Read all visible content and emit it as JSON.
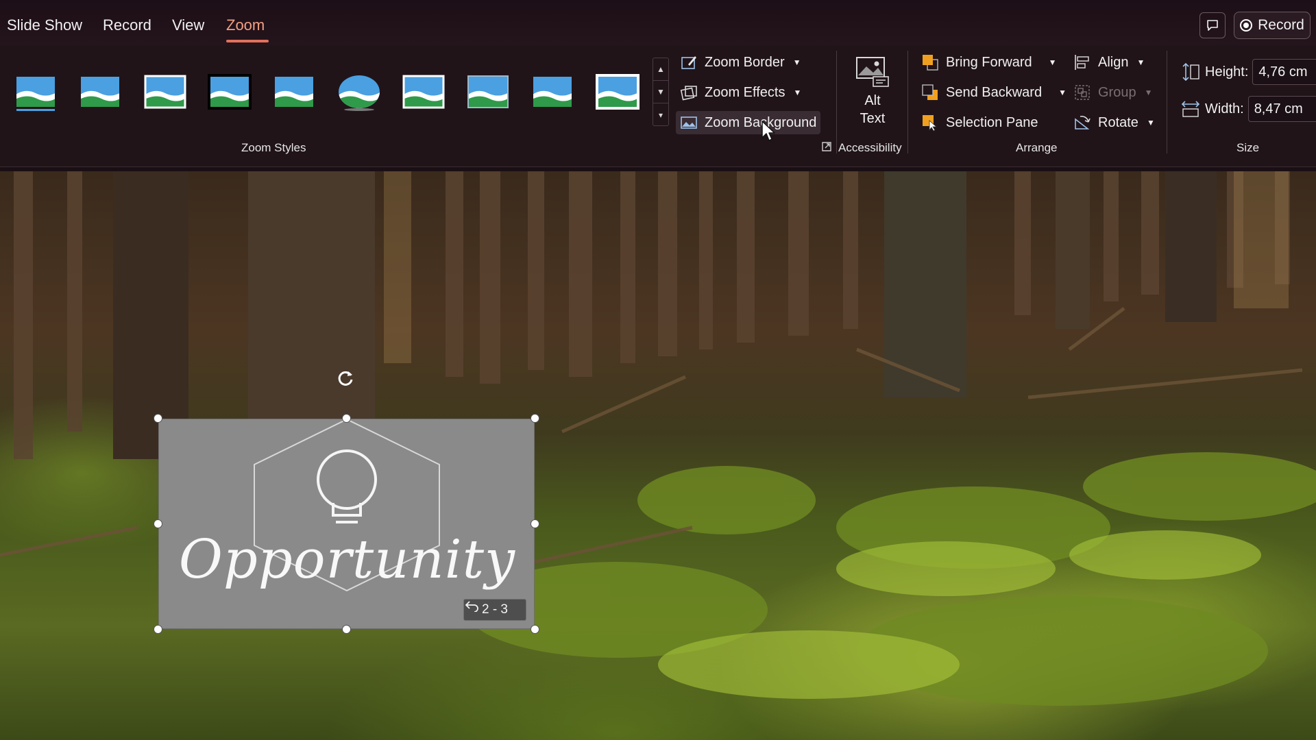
{
  "menu": {
    "tabs": [
      {
        "label": "Slide Show"
      },
      {
        "label": "Record"
      },
      {
        "label": "View"
      },
      {
        "label": "Zoom",
        "active": true
      }
    ],
    "record_button": "Record",
    "accent_color": "#e2705a"
  },
  "ribbon": {
    "zoom_styles": {
      "label": "Zoom Styles",
      "thumbnail_count": 10
    },
    "zoom_buttons": {
      "border": "Zoom Border",
      "effects": "Zoom Effects",
      "background": "Zoom Background"
    },
    "accessibility": {
      "label": "Accessibility",
      "alt_text_line1": "Alt",
      "alt_text_line2": "Text"
    },
    "arrange": {
      "label": "Arrange",
      "bring_forward": "Bring Forward",
      "send_backward": "Send Backward",
      "selection_pane": "Selection Pane",
      "align": "Align",
      "group": "Group",
      "rotate": "Rotate"
    },
    "size": {
      "label": "Size",
      "height_label": "Height:",
      "height_value": "4,76 cm",
      "width_label": "Width:",
      "width_value": "8,47 cm"
    }
  },
  "slide": {
    "zoom_object": {
      "title": "Opportunity",
      "badge": "2 - 3",
      "fill_color": "#8a8a8a"
    }
  }
}
